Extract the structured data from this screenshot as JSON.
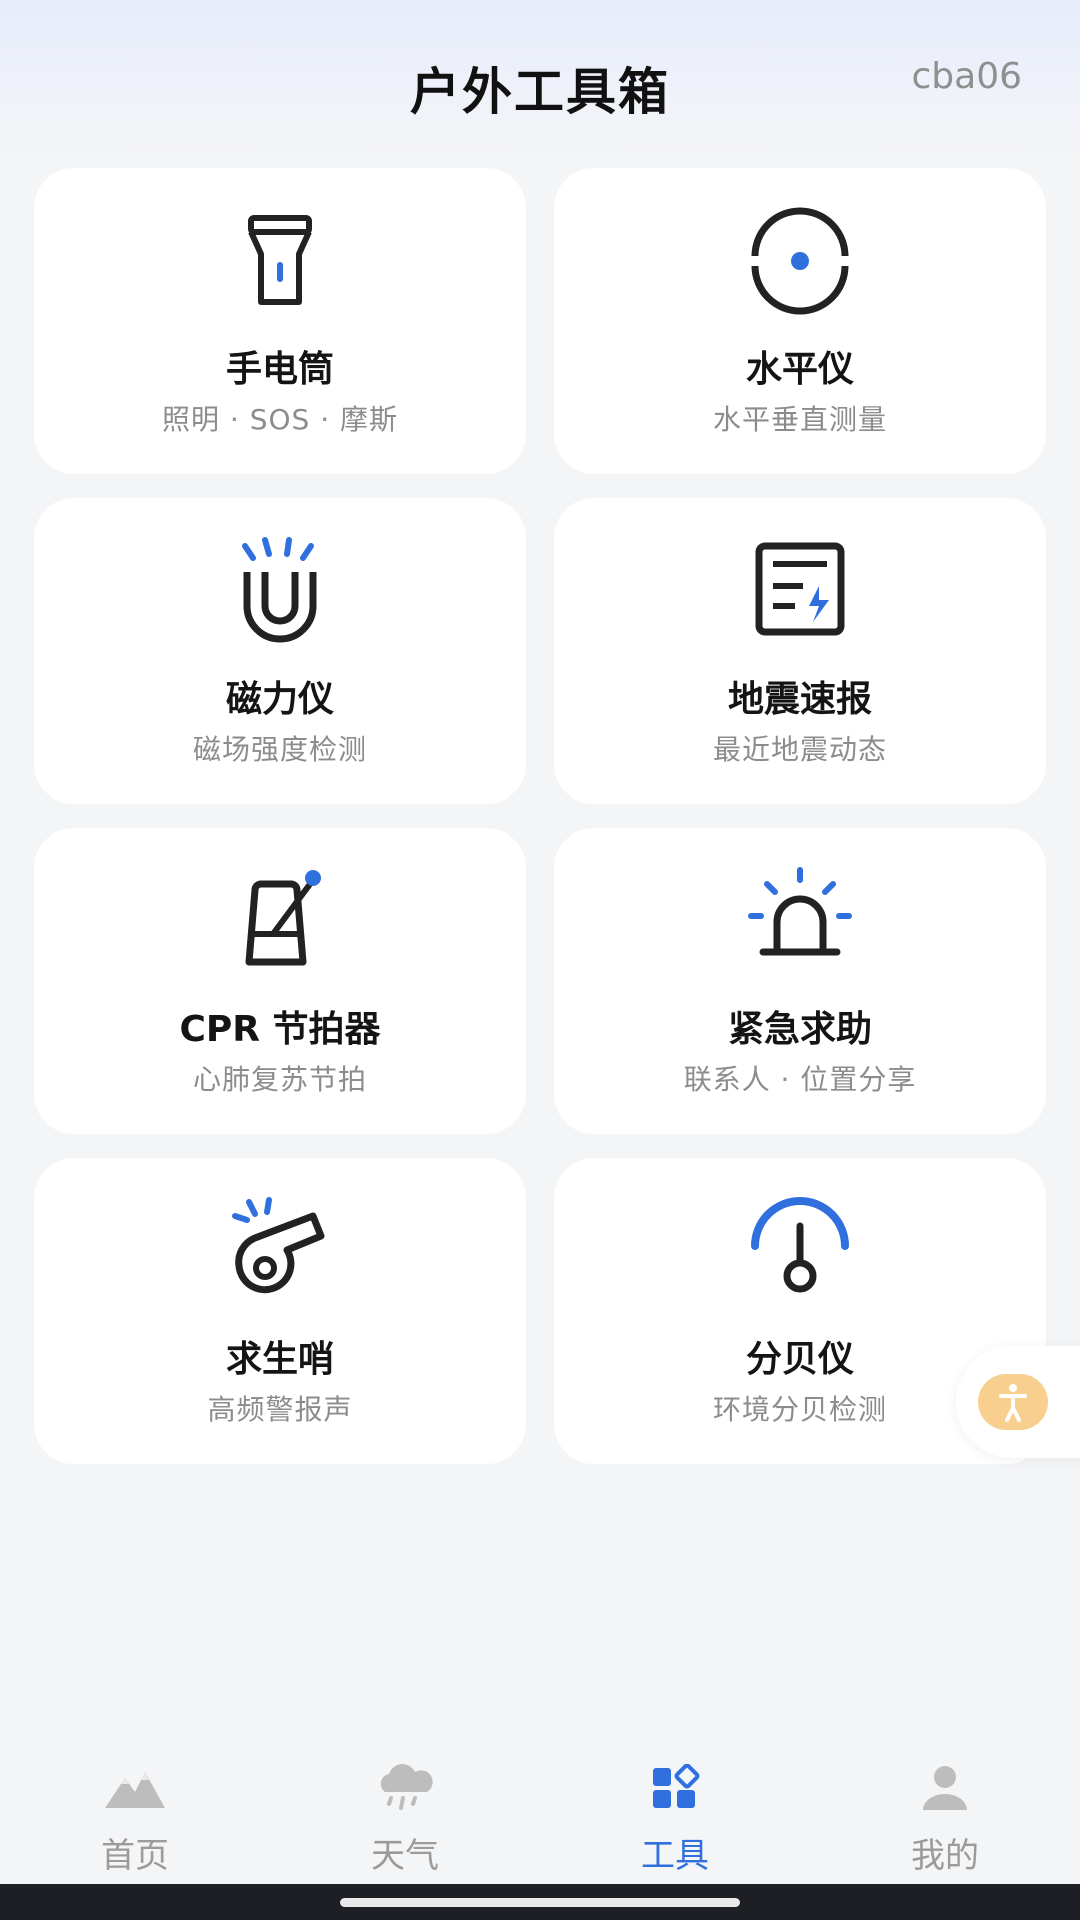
{
  "header": {
    "title": "户外工具箱",
    "badge": "cba06"
  },
  "tools": [
    {
      "name": "手电筒",
      "desc": "照明 · SOS · 摩斯",
      "icon": "flashlight-icon"
    },
    {
      "name": "水平仪",
      "desc": "水平垂直测量",
      "icon": "level-icon"
    },
    {
      "name": "磁力仪",
      "desc": "磁场强度检测",
      "icon": "magnet-icon"
    },
    {
      "name": "地震速报",
      "desc": "最近地震动态",
      "icon": "earthquake-report-icon"
    },
    {
      "name": "CPR 节拍器",
      "desc": "心肺复苏节拍",
      "icon": "metronome-icon"
    },
    {
      "name": "紧急求助",
      "desc": "联系人 · 位置分享",
      "icon": "alarm-light-icon"
    },
    {
      "name": "求生哨",
      "desc": "高频警报声",
      "icon": "whistle-icon"
    },
    {
      "name": "分贝仪",
      "desc": "环境分贝检测",
      "icon": "decibel-meter-icon"
    }
  ],
  "floating_button": {
    "icon": "accessibility-icon"
  },
  "tabbar": {
    "active": "工具",
    "items": [
      {
        "label": "首页",
        "icon": "mountain-icon"
      },
      {
        "label": "天气",
        "icon": "rain-cloud-icon"
      },
      {
        "label": "工具",
        "icon": "tools-grid-icon"
      },
      {
        "label": "我的",
        "icon": "user-icon"
      }
    ]
  },
  "colors": {
    "accent": "#2f6fde",
    "icon_dark": "#222222",
    "float": "#f9cf8f"
  }
}
